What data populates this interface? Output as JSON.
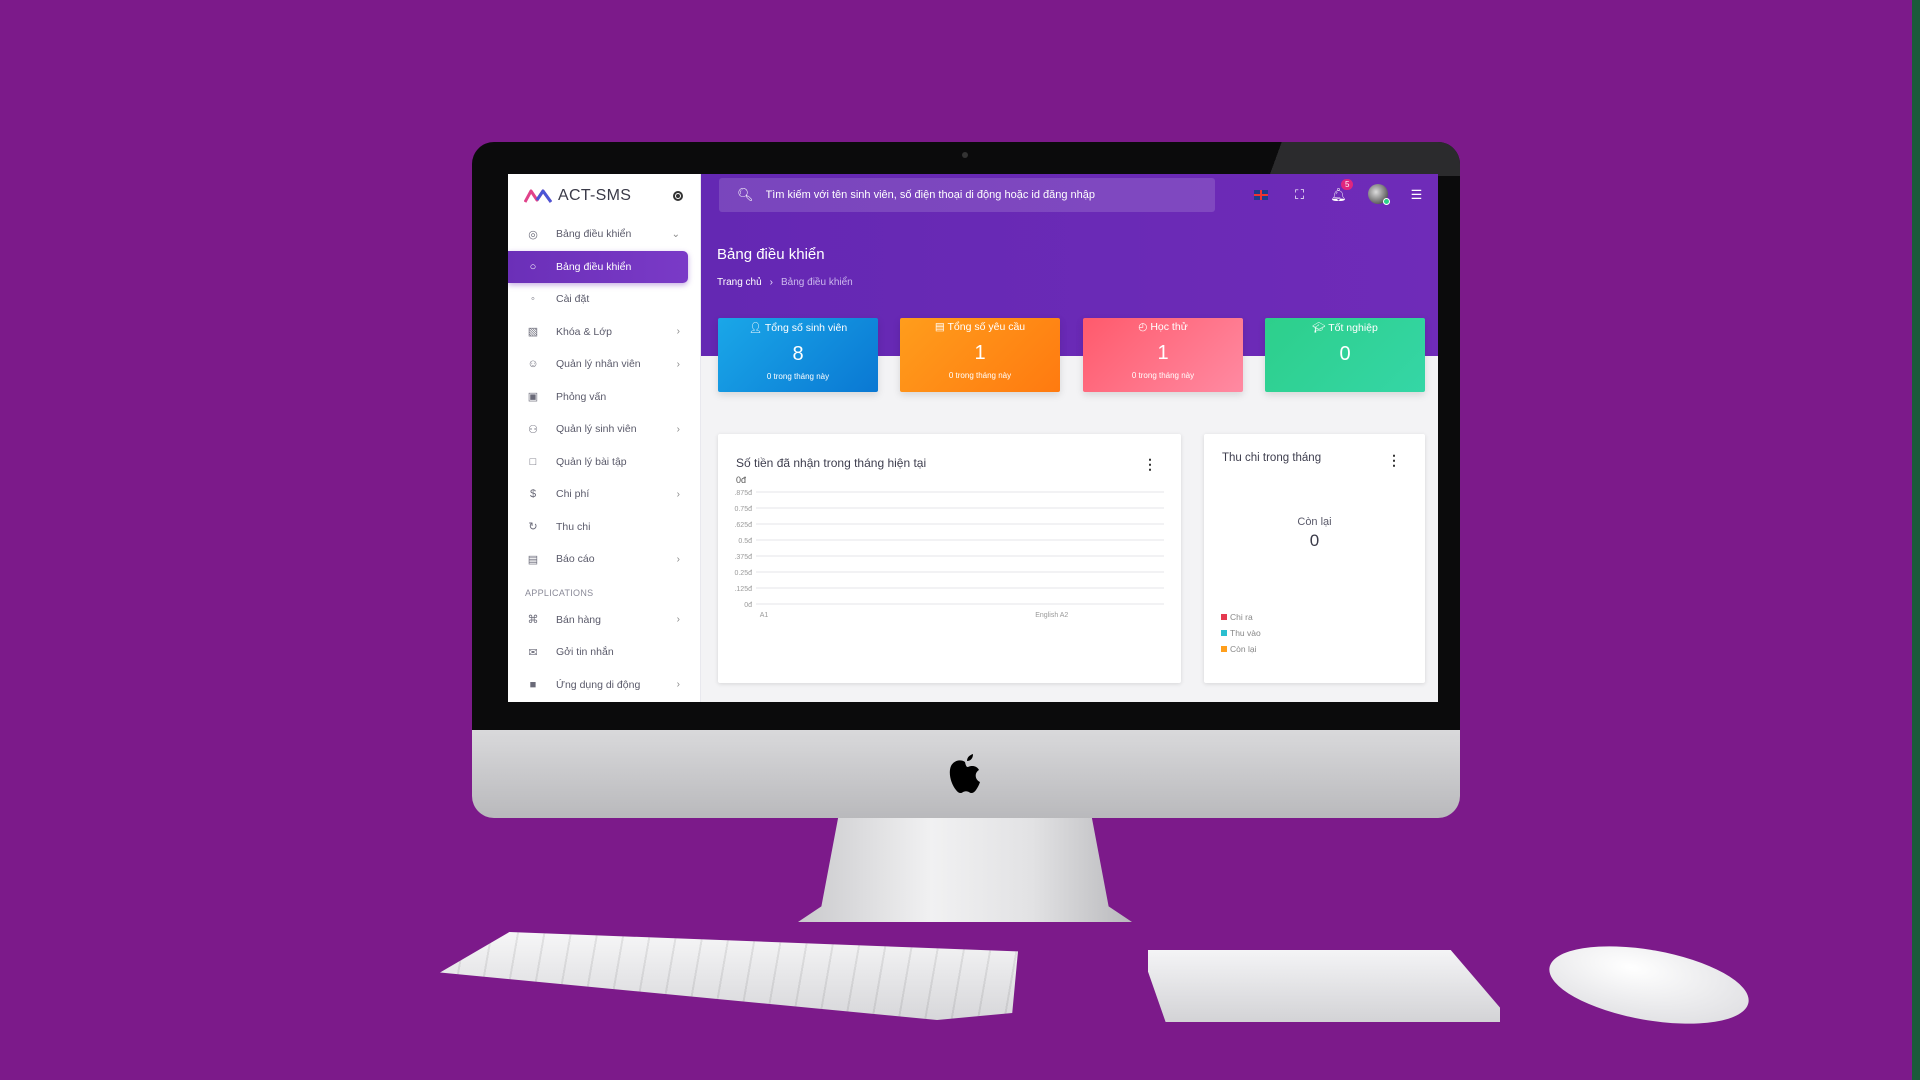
{
  "app": {
    "brand": "ACT-SMS"
  },
  "search": {
    "placeholder": "Tìm kiếm với tên sinh viên, số điện thoại di động hoặc id đăng nhập"
  },
  "header": {
    "notification_count": "5"
  },
  "sidebar": {
    "items": [
      {
        "label": "Bảng điều khiển",
        "icon": "palette-icon",
        "chevron": "⌄"
      },
      {
        "label": "Bảng điều khiển",
        "icon": "circle-icon",
        "active": true
      },
      {
        "label": "Cài đặt",
        "icon": "circle-icon"
      },
      {
        "label": "Khóa & Lớp",
        "icon": "book-icon",
        "chevron": "›"
      },
      {
        "label": "Quản lý nhân viên",
        "icon": "face-icon",
        "chevron": "›"
      },
      {
        "label": "Phỏng vấn",
        "icon": "id-card-icon"
      },
      {
        "label": "Quản lý sinh viên",
        "icon": "people-icon",
        "chevron": "›"
      },
      {
        "label": "Quản lý bài tập",
        "icon": "clipboard-icon"
      },
      {
        "label": "Chi phí",
        "icon": "dollar-icon",
        "chevron": "›"
      },
      {
        "label": "Thu chi",
        "icon": "cycle-icon"
      },
      {
        "label": "Báo cáo",
        "icon": "report-icon",
        "chevron": "›"
      }
    ],
    "section_title": "APPLICATIONS",
    "app_items": [
      {
        "label": "Bán hàng",
        "icon": "cart-icon",
        "chevron": "›"
      },
      {
        "label": "Gởi tin nhắn",
        "icon": "mail-icon"
      },
      {
        "label": "Ứng dụng di động",
        "icon": "android-icon",
        "chevron": "›"
      }
    ]
  },
  "page": {
    "title": "Bảng điều khiển",
    "breadcrumb": {
      "home": "Trang chủ",
      "separator": "›",
      "current": "Bảng điều khiển"
    }
  },
  "stats": [
    {
      "title": "Tổng số sinh viên",
      "icon": "user-icon",
      "value": "8",
      "footer": "0 trong tháng này",
      "color": "#0f8fde"
    },
    {
      "title": "Tổng số yêu cầu",
      "icon": "card-icon",
      "value": "1",
      "footer": "0 trong tháng này",
      "color": "#ff8c16"
    },
    {
      "title": "Học thử",
      "icon": "clock-icon",
      "value": "1",
      "footer": "0 trong tháng này",
      "color": "#ff6f86"
    },
    {
      "title": "Tốt nghiệp",
      "icon": "graduation-icon",
      "value": "0",
      "footer": "",
      "color": "#30d399"
    }
  ],
  "income_card": {
    "title": "Số tiền đã nhận trong tháng hiện tại",
    "more": "⋮",
    "total": "0đ"
  },
  "chart_data": {
    "type": "bar",
    "title": "Số tiền đã nhận trong tháng hiện tại",
    "categories": [
      "A1",
      "English A2"
    ],
    "values": [
      0,
      0
    ],
    "y_ticks": [
      ".875đ",
      "0.75đ",
      ".625đ",
      "0.5đ",
      ".375đ",
      "0.25đ",
      ".125đ",
      "0đ"
    ],
    "ylim": [
      0,
      0.875
    ],
    "grid": true
  },
  "balance_card": {
    "title": "Thu chi trong tháng",
    "more": "⋮",
    "center_label": "Còn lại",
    "center_value": "0",
    "legend": [
      {
        "label": "Chi ra",
        "color": "#e53950"
      },
      {
        "label": "Thu vào",
        "color": "#2bbfcf"
      },
      {
        "label": "Còn lại",
        "color": "#ff9f1c"
      }
    ]
  }
}
